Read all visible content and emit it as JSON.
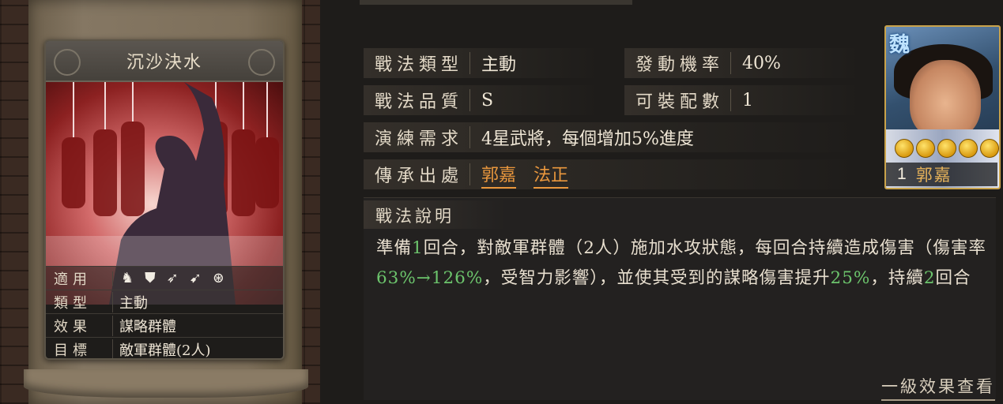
{
  "card": {
    "name": "沉沙決水",
    "stats": [
      {
        "label": "適用",
        "icons": [
          "cavalry-icon",
          "shield-icon",
          "bow-icon",
          "spear-icon",
          "wheel-icon"
        ]
      },
      {
        "label": "類型",
        "value": "主動"
      },
      {
        "label": "效果",
        "value": "謀略群體"
      },
      {
        "label": "目標",
        "value": "敵軍群體(2人)"
      }
    ]
  },
  "info": {
    "rows": [
      {
        "label": "戰法類型",
        "value": "主動"
      },
      {
        "label": "發動機率",
        "value": "40%"
      },
      {
        "label": "戰法品質",
        "value": "S"
      },
      {
        "label": "可裝配數",
        "value": "1"
      },
      {
        "label": "演練需求",
        "value": "4星武將，每個增加5%進度"
      },
      {
        "label": "傳承出處",
        "heroes": [
          "郭嘉",
          "法正"
        ]
      }
    ]
  },
  "description": {
    "title": "戰法說明",
    "segments": [
      {
        "text": "準備"
      },
      {
        "text": "1",
        "highlight": true
      },
      {
        "text": "回合，對敵軍群體（2人）施加水攻狀態，每回合持續造成傷害（傷害率"
      },
      {
        "text": "63%→126%",
        "highlight": true
      },
      {
        "text": "，受智力影響），並使其受到的謀略傷害提升"
      },
      {
        "text": "25%",
        "highlight": true
      },
      {
        "text": "，持續"
      },
      {
        "text": "2",
        "highlight": true
      },
      {
        "text": "回合"
      }
    ],
    "more_button": "一級效果查看"
  },
  "portrait": {
    "kingdom": "魏",
    "stars": 5,
    "level": "1",
    "name": "郭嘉"
  },
  "colors": {
    "highlight": "#6cc46c",
    "hero_link": "#e9973d"
  }
}
